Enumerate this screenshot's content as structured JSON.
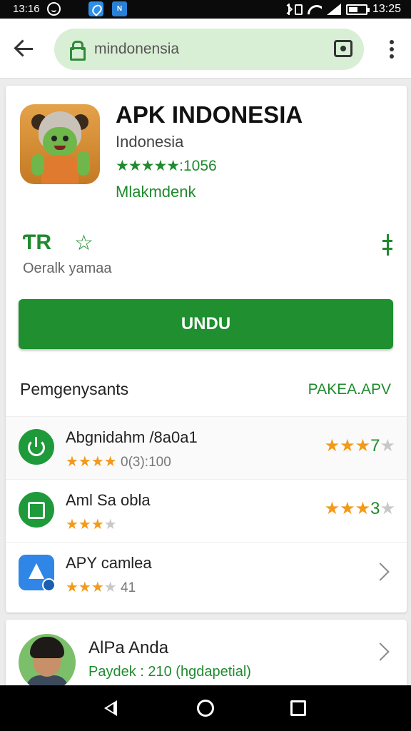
{
  "status_bar": {
    "time_left": "13:16",
    "app_badge": "N",
    "time_right": "13:25"
  },
  "browser": {
    "url": "mindonensia"
  },
  "app": {
    "title": "APK INDONESIA",
    "developer": "Indonesia",
    "rating_stars": "★★★★★",
    "rating_count": ":1056",
    "category": "Mlakmdenk",
    "action_icon_text": "ƬR",
    "info_text": "Oeralk yamaa",
    "install_label": "UNDU",
    "accent_color": "#1f8f2f"
  },
  "section": {
    "title": "Pemgenysants",
    "link": "PAKEA.APV"
  },
  "list": [
    {
      "icon": "power-icon",
      "title": "Abgnidahm /8a0a1",
      "sub_stars": "★★★★",
      "sub_text": "0(3):100",
      "rating_stars": "★★★",
      "rating_value": "7",
      "rating_dim": "★"
    },
    {
      "icon": "chat-icon",
      "title": "Aml Sa obla",
      "sub_stars": "★★★",
      "sub_dim": "★",
      "rating_stars": "★★★",
      "rating_value": "3",
      "rating_dim": "★"
    },
    {
      "icon": "app-store-icon",
      "title": "APY camlea",
      "sub_stars": "★★★",
      "sub_dim": "★",
      "sub_text": "41"
    }
  ],
  "author": {
    "name": "AlPa Anda",
    "sub": "Paydek : 210 (hgdapetial)"
  }
}
